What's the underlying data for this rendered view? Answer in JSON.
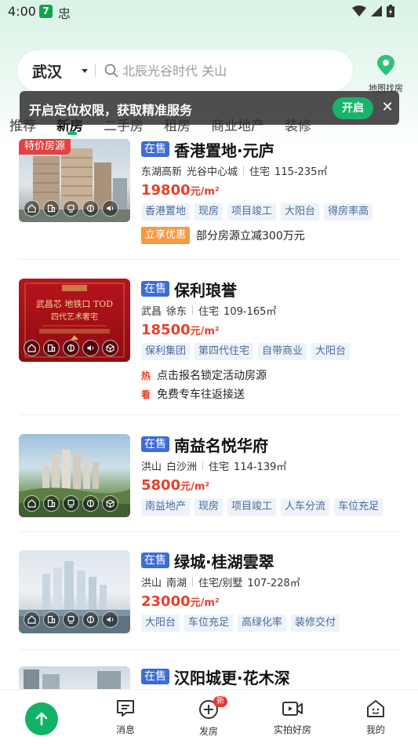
{
  "status_bar": {
    "time": "4:00",
    "app1": "7",
    "app2": "忠"
  },
  "search": {
    "city": "武汉",
    "placeholder": "北辰光谷时代 关山"
  },
  "map_find": {
    "label": "地图找房"
  },
  "location_banner": {
    "text": "开启定位权限，获取精准服务",
    "button": "开启",
    "close": "✕"
  },
  "tabs": [
    "推荐",
    "新房",
    "二手房",
    "租房",
    "商业地产",
    "装修"
  ],
  "active_tab": "新房",
  "colors": {
    "accent": "#19b46a",
    "price": "#e8402a",
    "sale_badge": "#3e6cd6",
    "promo": "#f59a3e"
  },
  "listings": [
    {
      "special_tag": "特价房源",
      "status": "在售",
      "name": "香港置地·元庐",
      "district": "东湖高新",
      "area": "光谷中心城",
      "type": "住宅",
      "size": "115-235㎡",
      "price": "19800",
      "price_unit": "元/m²",
      "tags": [
        "香港置地",
        "现房",
        "项目竣工",
        "大阳台",
        "得房率高"
      ],
      "promo_badge": "立享优惠",
      "promo_text": "部分房源立减300万元"
    },
    {
      "status": "在售",
      "name": "保利琅誉",
      "district": "武昌",
      "area": "徐东",
      "type": "住宅",
      "size": "109-165㎡",
      "price": "18500",
      "price_unit": "元/m²",
      "tags": [
        "保利集团",
        "第四代住宅",
        "自带商业",
        "大阳台"
      ],
      "thumb_text_1": "武昌芯 地铁口 TOD",
      "thumb_text_2": "四代艺术奢宅",
      "activities": [
        {
          "icon": "热",
          "text": "点击报名锁定活动房源"
        },
        {
          "icon": "看",
          "text": "免费专车往返接送"
        }
      ]
    },
    {
      "status": "在售",
      "name": "南益名悦华府",
      "district": "洪山",
      "area": "白沙洲",
      "type": "住宅",
      "size": "114-139㎡",
      "price": "5800",
      "price_unit": "元/m²",
      "tags": [
        "南益地产",
        "现房",
        "项目竣工",
        "人车分流",
        "车位充足"
      ]
    },
    {
      "status": "在售",
      "name": "绿城·桂湖雲翠",
      "district": "洪山",
      "area": "南湖",
      "type": "住宅/别墅",
      "size": "107-228㎡",
      "price": "23000",
      "price_unit": "元/m²",
      "tags": [
        "大阳台",
        "车位充足",
        "高绿化率",
        "装修交付"
      ]
    },
    {
      "status": "在售",
      "name": "汉阳城更·花木深"
    }
  ],
  "bottom_nav": {
    "messages": "消息",
    "publish": "发房",
    "publish_badge": "新",
    "live": "实拍好房",
    "mine": "我的"
  }
}
